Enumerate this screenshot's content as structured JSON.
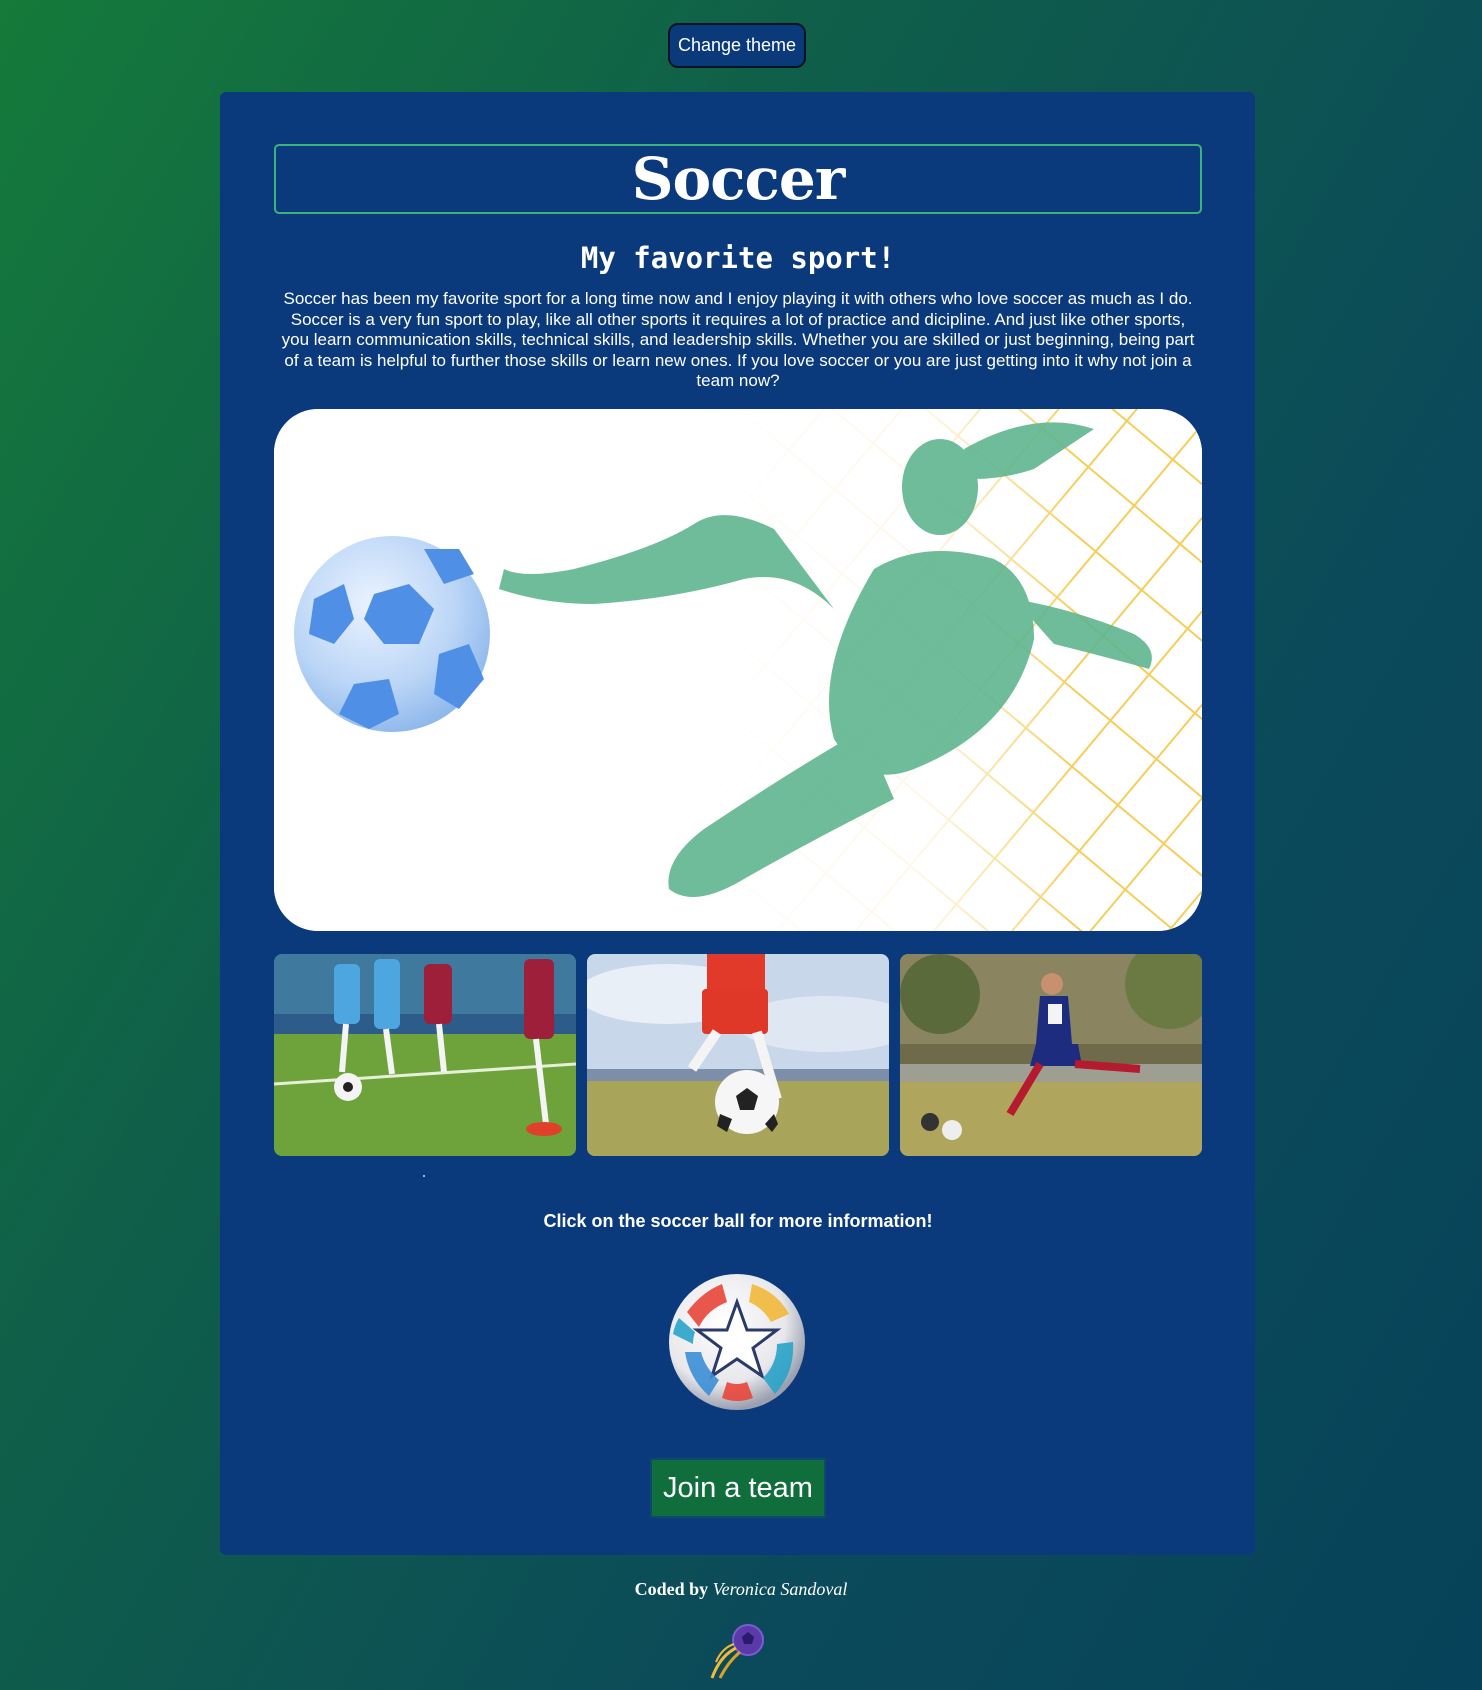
{
  "header": {
    "theme_button_label": "Change theme"
  },
  "card": {
    "title": "Soccer",
    "subtitle": "My favorite sport!",
    "intro": "Soccer has been my favorite sport for a long time now and I enjoy playing it with others who love soccer as much as I do. Soccer is a very fun sport to play, like all other sports it requires a lot of practice and dicipline. And just like other sports, you learn communication skills, technical skills, and leadership skills. Whether you are skilled or just beginning, being part of a team is helpful to further those skills or learn new ones. If you love soccer or you are just getting into it why not join a team now?",
    "info_text": "Click on the soccer ball for more information!",
    "join_button_label": "Join a team"
  },
  "footer": {
    "coded_by": "Coded by",
    "author": "Veronica Sandoval"
  },
  "colors": {
    "background_start": "#157a3a",
    "background_end": "#064259",
    "card": "#0b3a7c",
    "title_border": "#3bb37f",
    "join_button": "#0f6e3c",
    "hero_player_tint": "#5fb58f",
    "hero_net": "#f3c53d",
    "hero_ball": "#5b9bea"
  },
  "icons": {
    "hero_image": "soccer-player-kick-image",
    "photo_1": "youth-soccer-match-photo",
    "photo_2": "player-kicking-ball-photo",
    "photo_3": "female-player-kicking-photo",
    "info_ball": "colorful-soccer-ball-icon",
    "footer_logo": "flying-soccer-ball-logo"
  }
}
